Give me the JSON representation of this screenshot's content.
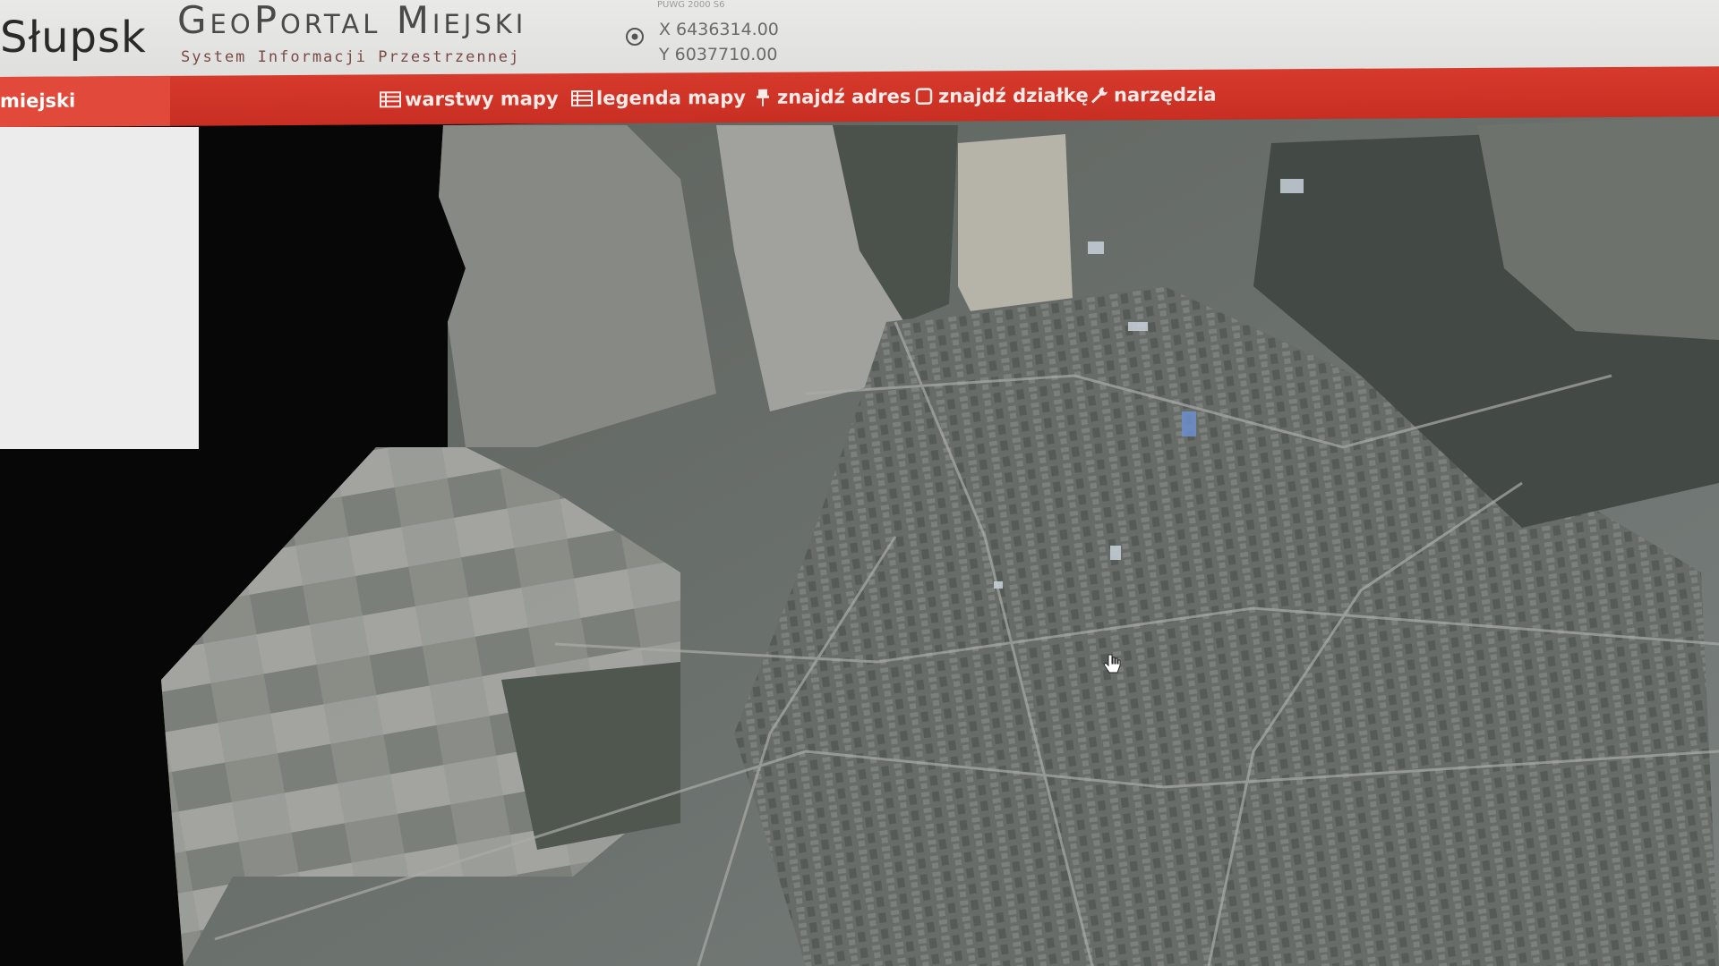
{
  "header": {
    "city_name": "Słupsk",
    "portal_title": "GeoPortal Miejski",
    "portal_subtitle": "System Informacji Przestrzennej",
    "coordinates": {
      "system": "PUWG 2000 S6",
      "x": "X 6436314.00",
      "y": "Y 6037710.00"
    }
  },
  "navbar": {
    "home_label": "miejski",
    "items": [
      {
        "label": "warstwy mapy",
        "icon": "list-icon"
      },
      {
        "label": "legenda mapy",
        "icon": "list-icon"
      },
      {
        "label": "znajdź adres",
        "icon": "pin-icon"
      },
      {
        "label": "znajdź działkę",
        "icon": "square-icon"
      },
      {
        "label": "narzędzia",
        "icon": "wrench-icon"
      }
    ]
  },
  "map": {
    "type": "satellite orthophoto"
  },
  "colors": {
    "nav_red": "#d0342a",
    "header_bg": "#e5e5e4",
    "map_dark": "#4a5048"
  }
}
